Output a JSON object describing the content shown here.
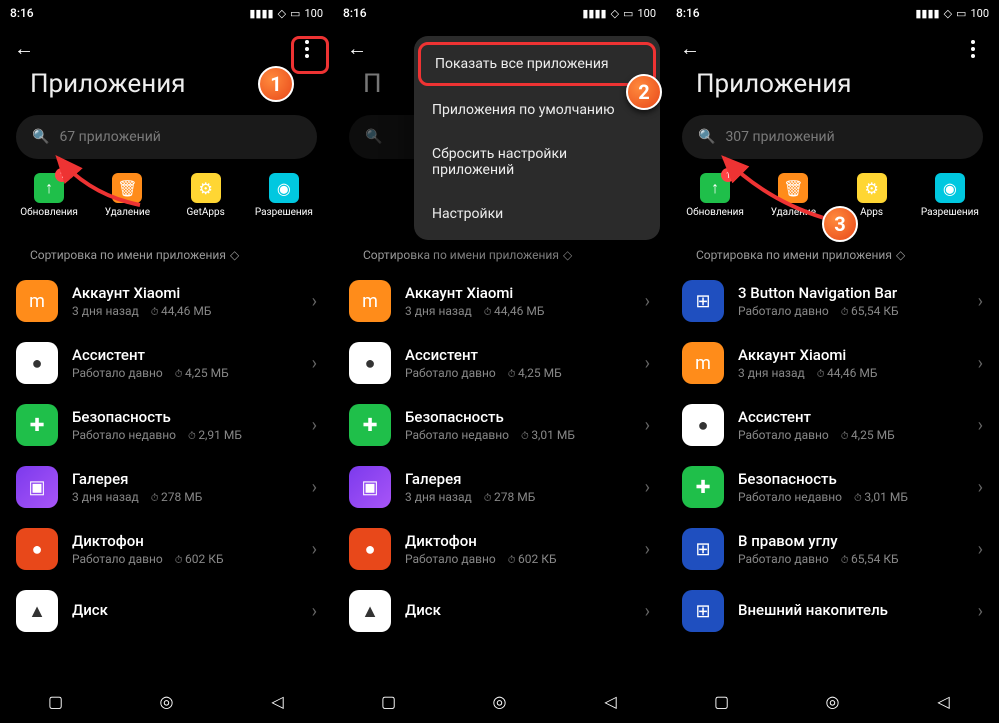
{
  "status": {
    "time": "8:16",
    "battery": "100"
  },
  "title": "Приложения",
  "menu": {
    "items": [
      "Показать все приложения",
      "Приложения по умолчанию",
      "Сбросить настройки приложений",
      "Настройки"
    ]
  },
  "quick": {
    "updates": "Обновления",
    "uninstall": "Удаление",
    "getapps": "GetApps",
    "permissions": "Разрешения",
    "badge": "1"
  },
  "sort": "Сортировка по имени приложения",
  "screens": [
    {
      "search": "67 приложений",
      "apps": [
        {
          "icon": "ic-xiaomi",
          "glyph": "m",
          "name": "Аккаунт Xiaomi",
          "meta1": "3 дня назад",
          "meta2": "44,46 МБ"
        },
        {
          "icon": "ic-assistant",
          "glyph": "●",
          "name": "Ассистент",
          "meta1": "Работало давно",
          "meta2": "4,25 МБ"
        },
        {
          "icon": "ic-security",
          "glyph": "✚",
          "name": "Безопасность",
          "meta1": "Работало недавно",
          "meta2": "2,91 МБ"
        },
        {
          "icon": "ic-gallery",
          "glyph": "▣",
          "name": "Галерея",
          "meta1": "3 дня назад",
          "meta2": "278 МБ"
        },
        {
          "icon": "ic-recorder",
          "glyph": "●",
          "name": "Диктофон",
          "meta1": "Работало давно",
          "meta2": "602 КБ"
        },
        {
          "icon": "ic-disk",
          "glyph": "▲",
          "name": "Диск",
          "meta1": "",
          "meta2": ""
        }
      ]
    },
    {
      "search": "",
      "apps": [
        {
          "icon": "ic-xiaomi",
          "glyph": "m",
          "name": "Аккаунт Xiaomi",
          "meta1": "3 дня назад",
          "meta2": "44,46 МБ"
        },
        {
          "icon": "ic-assistant",
          "glyph": "●",
          "name": "Ассистент",
          "meta1": "Работало давно",
          "meta2": "4,25 МБ"
        },
        {
          "icon": "ic-security",
          "glyph": "✚",
          "name": "Безопасность",
          "meta1": "Работало недавно",
          "meta2": "3,01 МБ"
        },
        {
          "icon": "ic-gallery",
          "glyph": "▣",
          "name": "Галерея",
          "meta1": "3 дня назад",
          "meta2": "278 МБ"
        },
        {
          "icon": "ic-recorder",
          "glyph": "●",
          "name": "Диктофон",
          "meta1": "Работало давно",
          "meta2": "602 КБ"
        },
        {
          "icon": "ic-disk",
          "glyph": "▲",
          "name": "Диск",
          "meta1": "",
          "meta2": ""
        }
      ]
    },
    {
      "search": "307 приложений",
      "apps": [
        {
          "icon": "ic-android",
          "glyph": "⊞",
          "name": "3 Button Navigation Bar",
          "meta1": "Работало давно",
          "meta2": "65,54 КБ"
        },
        {
          "icon": "ic-xiaomi",
          "glyph": "m",
          "name": "Аккаунт Xiaomi",
          "meta1": "3 дня назад",
          "meta2": "44,46 МБ"
        },
        {
          "icon": "ic-assistant",
          "glyph": "●",
          "name": "Ассистент",
          "meta1": "Работало давно",
          "meta2": "4,25 МБ"
        },
        {
          "icon": "ic-security",
          "glyph": "✚",
          "name": "Безопасность",
          "meta1": "Работало недавно",
          "meta2": "3,01 МБ"
        },
        {
          "icon": "ic-android",
          "glyph": "⊞",
          "name": "В правом углу",
          "meta1": "Работало давно",
          "meta2": "65,54 КБ"
        },
        {
          "icon": "ic-android",
          "glyph": "⊞",
          "name": "Внешний накопитель",
          "meta1": "",
          "meta2": ""
        }
      ]
    }
  ],
  "annotations": {
    "n1": "1",
    "n2": "2",
    "n3": "3"
  }
}
